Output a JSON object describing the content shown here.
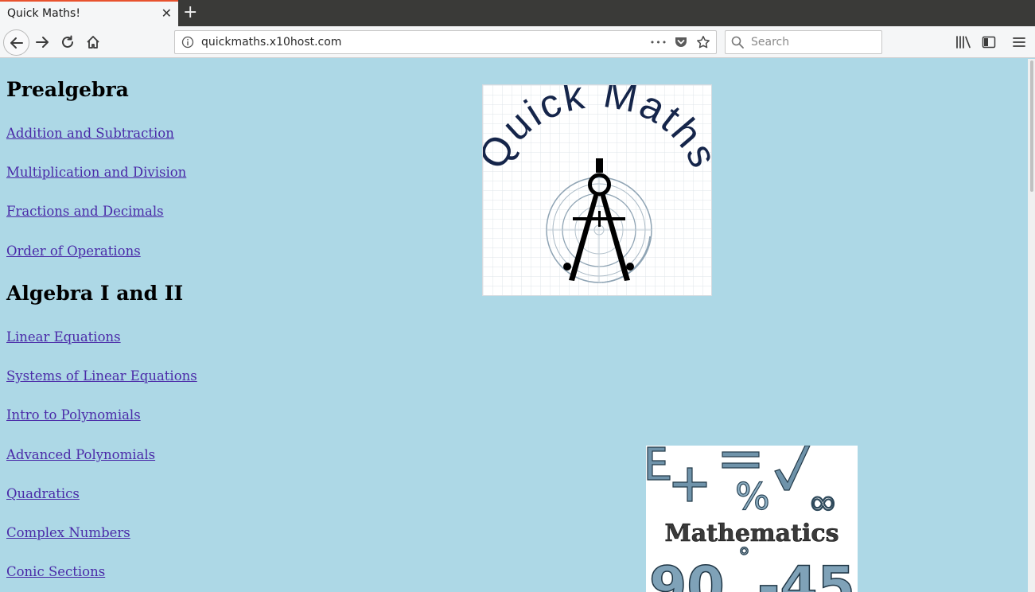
{
  "browser": {
    "tab_title": "Quick Maths!",
    "tab_close": "✕",
    "new_tab": "+",
    "url": "quickmaths.x10host.com",
    "url_actions_more": "•••",
    "search_placeholder": "Search"
  },
  "sections": [
    {
      "title": "Prealgebra",
      "links": [
        "Addition and Subtraction",
        "Multiplication and Division",
        "Fractions and Decimals",
        "Order of Operations"
      ]
    },
    {
      "title": "Algebra I and II",
      "links": [
        "Linear Equations",
        "Systems of Linear Equations",
        "Intro to Polynomials",
        "Advanced Polynomials",
        "Quadratics",
        "Complex Numbers",
        "Conic Sections"
      ]
    }
  ],
  "logo": {
    "text": "Quick Maths",
    "text_color": "#15254a"
  },
  "math_image": {
    "word": "Mathematics",
    "symbols": [
      "+",
      "=",
      "%",
      "√",
      "∞",
      "90",
      "°",
      "-45"
    ]
  },
  "colors": {
    "page_bg": "#add8e6",
    "link": "#4a2aa8",
    "tab_accent": "#e8522e"
  }
}
